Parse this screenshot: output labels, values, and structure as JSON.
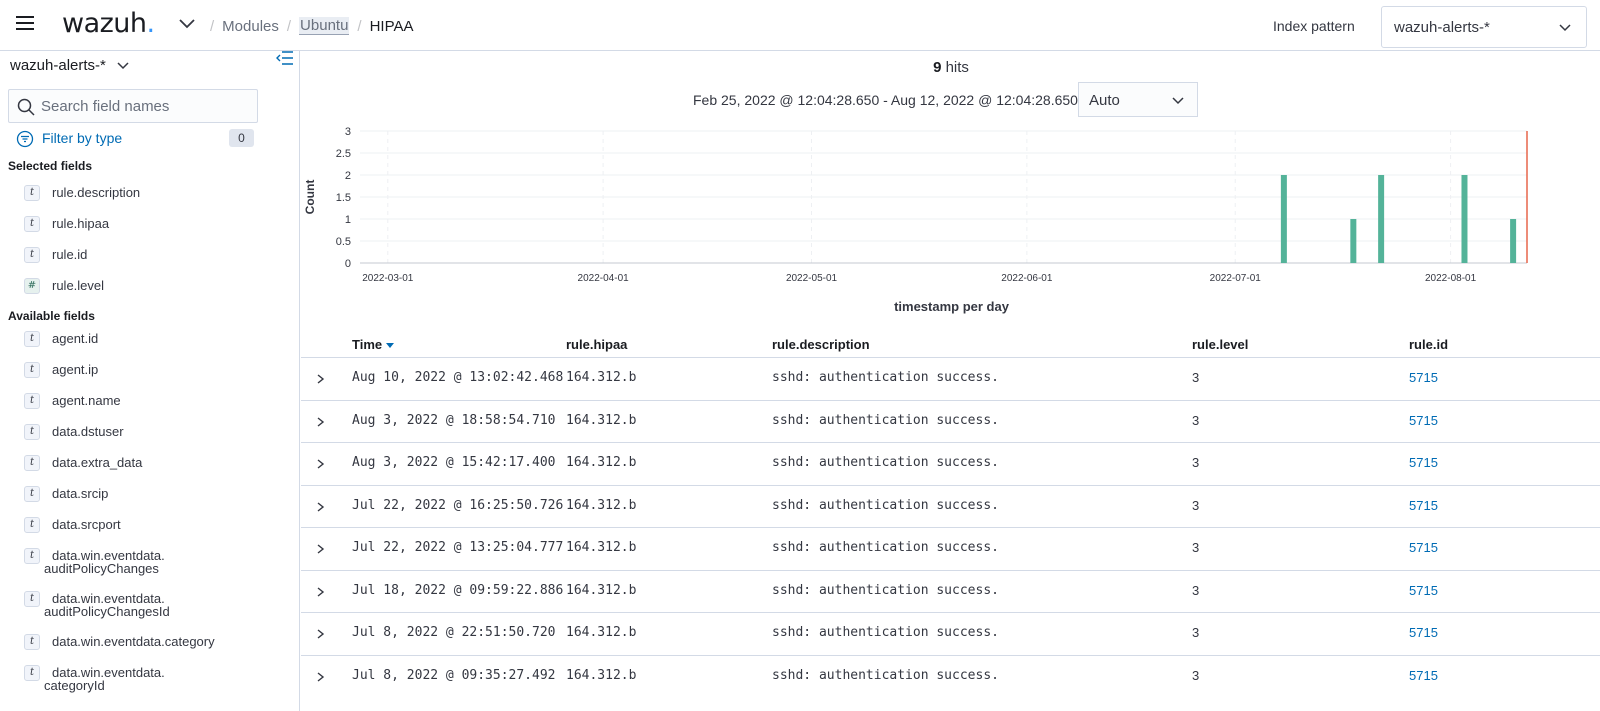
{
  "header": {
    "logo_text": "wazuh",
    "breadcrumbs": [
      "Modules",
      "Ubuntu",
      "HIPAA"
    ],
    "index_pattern_label": "Index pattern",
    "index_pattern_value": "wazuh-alerts-*"
  },
  "sidebar": {
    "index_title": "wazuh-alerts-*",
    "search_placeholder": "Search field names",
    "filter_label": "Filter by type",
    "filter_count": "0",
    "selected_title": "Selected fields",
    "available_title": "Available fields",
    "selected_fields": [
      {
        "type": "t",
        "name": "rule.description"
      },
      {
        "type": "t",
        "name": "rule.hipaa"
      },
      {
        "type": "t",
        "name": "rule.id"
      },
      {
        "type": "#",
        "name": "rule.level"
      }
    ],
    "available_fields": [
      {
        "type": "t",
        "name": "agent.id"
      },
      {
        "type": "t",
        "name": "agent.ip"
      },
      {
        "type": "t",
        "name": "agent.name"
      },
      {
        "type": "t",
        "name": "data.dstuser"
      },
      {
        "type": "t",
        "name": "data.extra_data"
      },
      {
        "type": "t",
        "name": "data.srcip"
      },
      {
        "type": "t",
        "name": "data.srcport"
      },
      {
        "type": "t",
        "name": "data.win.eventdata.",
        "name2": "auditPolicyChanges"
      },
      {
        "type": "t",
        "name": "data.win.eventdata.",
        "name2": "auditPolicyChangesId"
      },
      {
        "type": "t",
        "name": "data.win.eventdata.category"
      },
      {
        "type": "t",
        "name": "data.win.eventdata.",
        "name2": "categoryId"
      }
    ]
  },
  "main": {
    "hits_count": "9",
    "hits_label": "hits",
    "time_range": "Feb 25, 2022 @ 12:04:28.650 - Aug 12, 2022 @ 12:04:28.650",
    "interval": "Auto",
    "columns": [
      "Time",
      "rule.hipaa",
      "rule.description",
      "rule.level",
      "rule.id"
    ],
    "rows": [
      {
        "time": "Aug 10, 2022 @ 13:02:42.468",
        "hipaa": "164.312.b",
        "desc": "sshd: authentication success.",
        "level": "3",
        "id": "5715"
      },
      {
        "time": "Aug 3, 2022 @ 18:58:54.710",
        "hipaa": "164.312.b",
        "desc": "sshd: authentication success.",
        "level": "3",
        "id": "5715"
      },
      {
        "time": "Aug 3, 2022 @ 15:42:17.400",
        "hipaa": "164.312.b",
        "desc": "sshd: authentication success.",
        "level": "3",
        "id": "5715"
      },
      {
        "time": "Jul 22, 2022 @ 16:25:50.726",
        "hipaa": "164.312.b",
        "desc": "sshd: authentication success.",
        "level": "3",
        "id": "5715"
      },
      {
        "time": "Jul 22, 2022 @ 13:25:04.777",
        "hipaa": "164.312.b",
        "desc": "sshd: authentication success.",
        "level": "3",
        "id": "5715"
      },
      {
        "time": "Jul 18, 2022 @ 09:59:22.886",
        "hipaa": "164.312.b",
        "desc": "sshd: authentication success.",
        "level": "3",
        "id": "5715"
      },
      {
        "time": "Jul 8, 2022 @ 22:51:50.720",
        "hipaa": "164.312.b",
        "desc": "sshd: authentication success.",
        "level": "3",
        "id": "5715"
      },
      {
        "time": "Jul 8, 2022 @ 09:35:27.492",
        "hipaa": "164.312.b",
        "desc": "sshd: authentication success.",
        "level": "3",
        "id": "5715"
      }
    ]
  },
  "chart_data": {
    "type": "bar",
    "xlabel": "timestamp per day",
    "ylabel": "Count",
    "ylim": [
      0,
      3
    ],
    "yticks": [
      "0",
      "0.5",
      "1",
      "1.5",
      "2",
      "2.5",
      "3"
    ],
    "xticks": [
      "2022-03-01",
      "2022-04-01",
      "2022-05-01",
      "2022-06-01",
      "2022-07-01",
      "2022-08-01"
    ],
    "xlim": [
      "2022-02-25",
      "2022-08-12"
    ],
    "x": [
      "2022-07-08",
      "2022-07-18",
      "2022-07-22",
      "2022-08-03",
      "2022-08-10"
    ],
    "values": [
      2,
      1,
      2,
      2,
      1
    ],
    "bar_color": "#54b399",
    "now_marker": "2022-08-12",
    "now_marker_color": "#e7664c"
  }
}
